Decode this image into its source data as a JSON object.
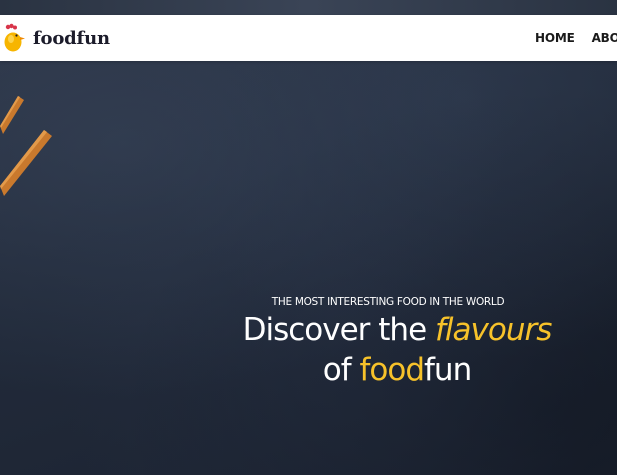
{
  "brand": {
    "name": "foodfun",
    "icon": "chicken-icon",
    "accent_color": "#f7c22a"
  },
  "nav": {
    "items": [
      "HOME",
      "ABOUT"
    ]
  },
  "hero": {
    "subtitle": "THE MOST INTERESTING FOOD IN THE WORLD",
    "title_line1_part1": "Discover the ",
    "title_line1_highlight": "flavours",
    "title_line2_part1": "of ",
    "title_line2_highlight": "food",
    "title_line2_part2": "fun",
    "background": "dark-slate-texture",
    "decoration": "chopsticks"
  }
}
